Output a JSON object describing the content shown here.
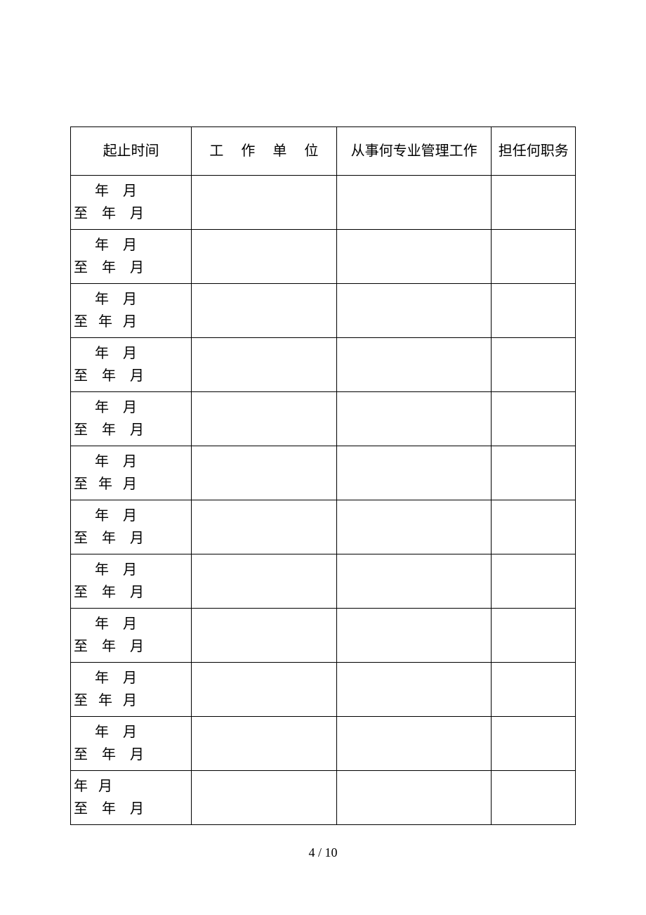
{
  "headers": {
    "time": "起止时间",
    "unit": "工 作 单 位",
    "work": "从事何专业管理工作",
    "position": "担任何职务"
  },
  "rows": [
    {
      "line1": "      年    月",
      "line2": "至    年    月",
      "unit": "",
      "work": "",
      "position": ""
    },
    {
      "line1": "      年    月",
      "line2": "至    年    月",
      "unit": "",
      "work": "",
      "position": ""
    },
    {
      "line1": "      年    月",
      "line2": "至   年   月",
      "unit": "",
      "work": "",
      "position": ""
    },
    {
      "line1": "      年    月",
      "line2": "至    年    月",
      "unit": "",
      "work": "",
      "position": ""
    },
    {
      "line1": "      年    月",
      "line2": "至    年    月",
      "unit": "",
      "work": "",
      "position": ""
    },
    {
      "line1": "      年    月",
      "line2": "至   年   月",
      "unit": "",
      "work": "",
      "position": ""
    },
    {
      "line1": "      年    月",
      "line2": "至    年    月",
      "unit": "",
      "work": "",
      "position": ""
    },
    {
      "line1": "      年    月",
      "line2": "至    年    月",
      "unit": "",
      "work": "",
      "position": ""
    },
    {
      "line1": "      年    月",
      "line2": "至    年    月",
      "unit": "",
      "work": "",
      "position": ""
    },
    {
      "line1": "      年    月",
      "line2": "至   年   月",
      "unit": "",
      "work": "",
      "position": ""
    },
    {
      "line1": "      年    月",
      "line2": "至    年    月",
      "unit": "",
      "work": "",
      "position": ""
    },
    {
      "line1": "年   月",
      "line2": "至    年    月",
      "unit": "",
      "work": "",
      "position": ""
    }
  ],
  "footer": "4 / 10"
}
